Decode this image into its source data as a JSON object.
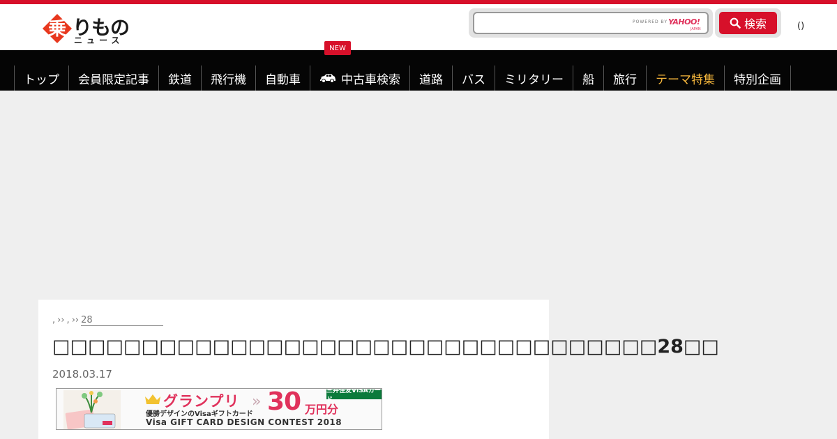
{
  "header": {
    "logo_main": "りもの",
    "logo_sub": "ニュース",
    "search_placeholder": "",
    "search_powered": "POWERED BY",
    "search_provider": "YAHOO!",
    "search_provider_sub": "JAPAN",
    "search_button_label": "検索",
    "login_label": "()"
  },
  "nav": {
    "new_badge": "NEW",
    "items": [
      {
        "label": "トップ"
      },
      {
        "label": "会員限定記事"
      },
      {
        "label": "鉄道"
      },
      {
        "label": "飛行機"
      },
      {
        "label": "自動車"
      },
      {
        "label": "中古車検索",
        "icon": "car-icon"
      },
      {
        "label": "道路"
      },
      {
        "label": "バス"
      },
      {
        "label": "ミリタリー"
      },
      {
        "label": "船"
      },
      {
        "label": "旅行"
      },
      {
        "label": "テーマ特集",
        "accent": true
      },
      {
        "label": "特別企画"
      }
    ]
  },
  "article": {
    "breadcrumb": {
      "sep1": ",",
      "sep2": "››",
      "sep3": ",",
      "sep4": "››",
      "last": "28"
    },
    "title": "□□□□□□□□□□□□□□□□□□□□□□□□□□□□□□□□□□28□□",
    "date": "2018.03.17"
  },
  "banner": {
    "headline": "グランプリ",
    "amount": "30",
    "unit": "万円分",
    "sponsor": "三井住友VISAカード",
    "subtitle": "優勝デザインのVisaギフトカード",
    "contest": "Visa GIFT CARD DESIGN CONTEST 2018"
  },
  "colors": {
    "brand_red": "#d7102a",
    "nav_bg": "#050505",
    "accent_orange": "#f6b73c"
  }
}
